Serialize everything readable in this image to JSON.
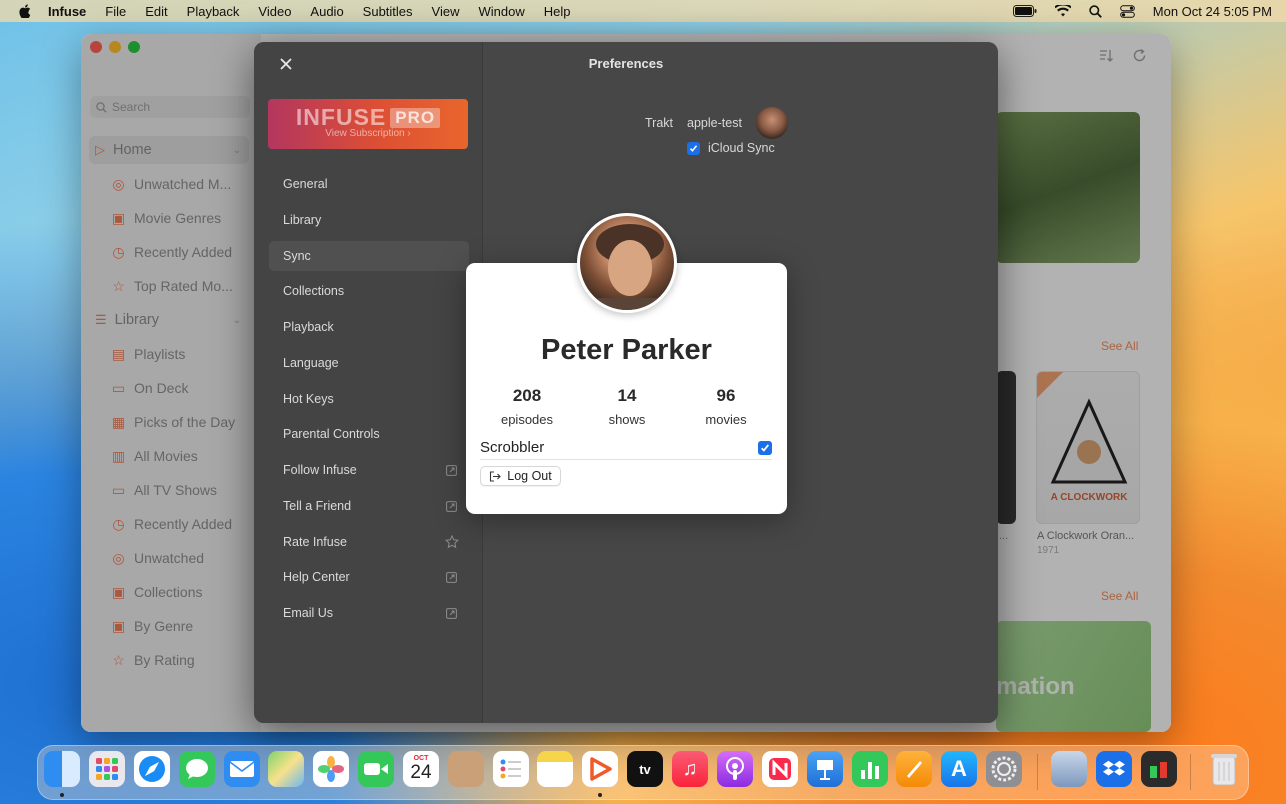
{
  "menubar": {
    "app": "Infuse",
    "items": [
      "File",
      "Edit",
      "Playback",
      "Video",
      "Audio",
      "Subtitles",
      "View",
      "Window",
      "Help"
    ],
    "datetime": "Mon Oct 24  5:05 PM"
  },
  "sidebar": {
    "search_placeholder": "Search",
    "home": "Home",
    "home_items": [
      "Unwatched M...",
      "Movie Genres",
      "Recently Added",
      "Top Rated Mo..."
    ],
    "library": "Library",
    "library_items": [
      "Playlists",
      "On Deck",
      "Picks of the Day",
      "All Movies",
      "All TV Shows",
      "Recently Added",
      "Unwatched",
      "Collections",
      "By Genre",
      "By Rating"
    ]
  },
  "content": {
    "see_all_1": "See All",
    "see_all_2": "See All",
    "movie_title": "A Clockwork Oran...",
    "movie_year": "1971",
    "trailing_dots": "...",
    "banner_text": "mation"
  },
  "preferences": {
    "title": "Preferences",
    "promo_logo": "INFUSE",
    "promo_badge": "PRO",
    "promo_sub": "View Subscription  ›",
    "menu": [
      "General",
      "Library",
      "Sync",
      "Collections",
      "Playback",
      "Language",
      "Hot Keys",
      "Parental Controls",
      "Follow Infuse",
      "Tell a Friend",
      "Rate Infuse",
      "Help Center",
      "Email Us"
    ],
    "selected": "Sync",
    "trakt_label": "Trakt",
    "trakt_user": "apple-test",
    "icloud_label": "iCloud Sync"
  },
  "profile": {
    "name": "Peter Parker",
    "stats": [
      {
        "value": "208",
        "label": "episodes"
      },
      {
        "value": "14",
        "label": "shows"
      },
      {
        "value": "96",
        "label": "movies"
      }
    ],
    "scrobbler_label": "Scrobbler",
    "scrobbler_checked": true,
    "logout_label": "Log Out"
  },
  "dock": {
    "calendar_month": "OCT",
    "calendar_day": "24",
    "apps": [
      "Finder",
      "Launchpad",
      "Safari",
      "Messages",
      "Mail",
      "Maps",
      "Photos",
      "FaceTime",
      "Calendar",
      "Contacts",
      "Reminders",
      "Notes",
      "Infuse",
      "TV",
      "Music",
      "Podcasts",
      "News",
      "Keynote",
      "Numbers",
      "Pages",
      "App Store",
      "System Settings",
      "Preview",
      "Dropbox",
      "Activity Monitor",
      "Trash"
    ],
    "colors": {
      "accent": "#f07b57",
      "checkbox": "#1b6fe8"
    }
  }
}
